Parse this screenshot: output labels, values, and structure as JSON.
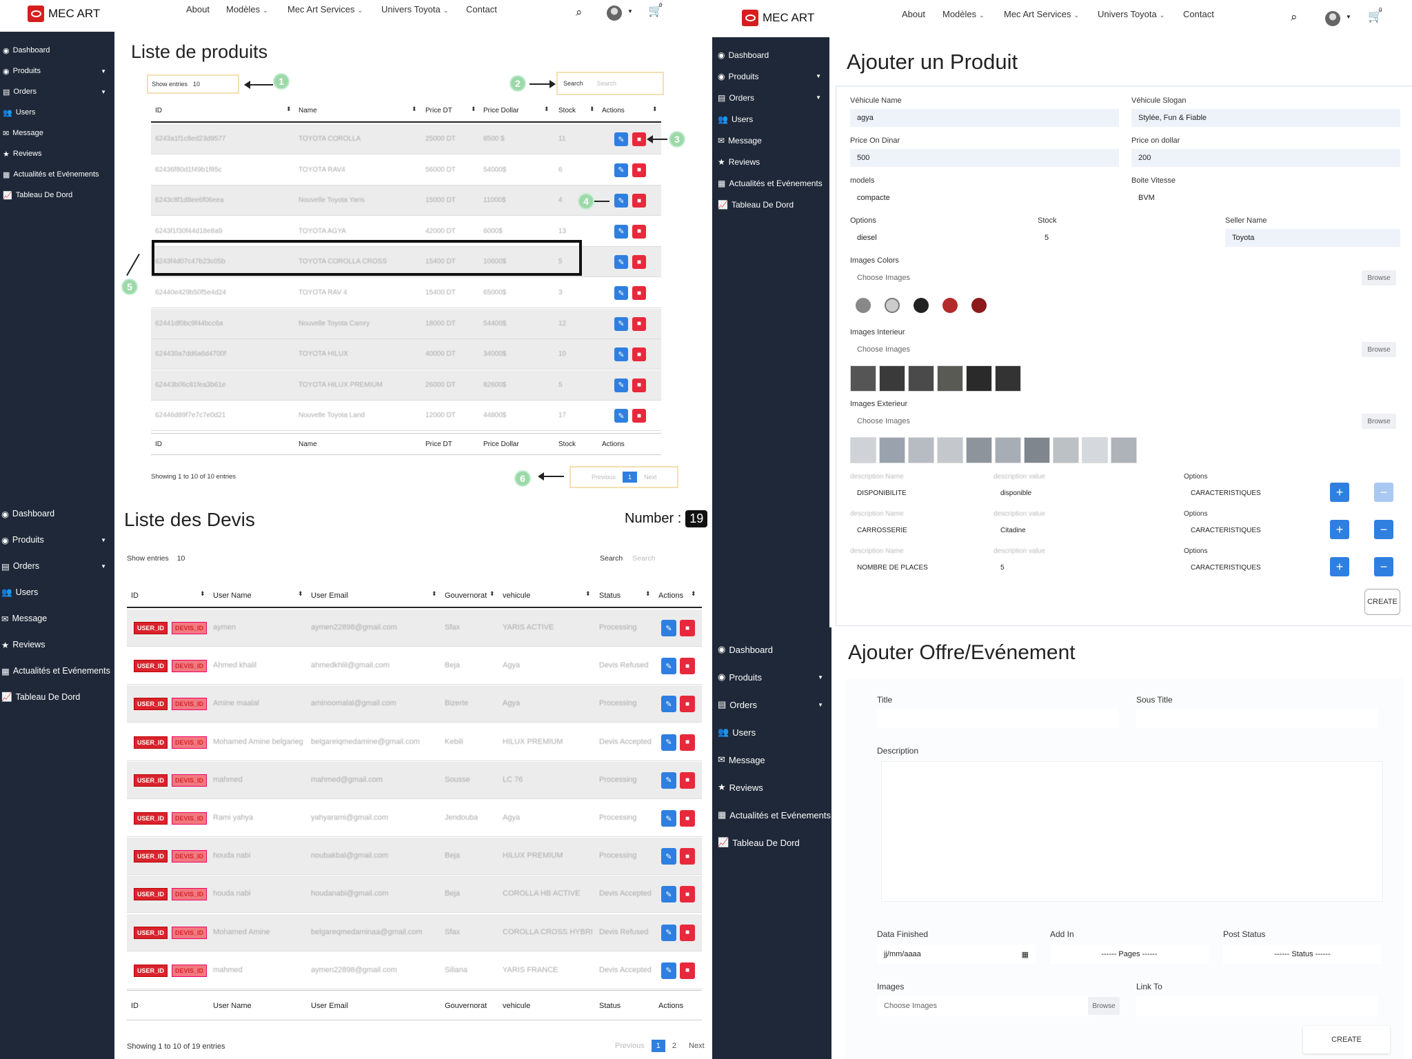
{
  "nav": {
    "brand": "MEC ART",
    "items": [
      "About",
      "Modèles",
      "Mec Art Services",
      "Univers Toyota",
      "Contact"
    ],
    "cart_count": "0"
  },
  "sidebar": [
    "Dashboard",
    "Produits",
    "Orders",
    "Users",
    "Message",
    "Reviews",
    "Actualités et Evénements",
    "Tableau De Dord"
  ],
  "products": {
    "title": "Liste de produits",
    "show_entries": "Show entries",
    "show_value": "10",
    "search_label": "Search",
    "search_placeholder": "Search",
    "columns": [
      "ID",
      "Name",
      "Price DT",
      "Price Dollar",
      "Stock",
      "Actions"
    ],
    "rows": [
      [
        "6243a1f1c8ed23d9577",
        "TOYOTA COROLLA",
        "25000 DT",
        "8500 $",
        "11"
      ],
      [
        "62436f80d1f49b1f85c",
        "TOYOTA RAV4 ",
        "56000 DT",
        "54000$",
        "6"
      ],
      [
        "6243c8f1d8ee6f06eea",
        "Nouvelle Toyota Yaris",
        "15000 DT",
        "11000$",
        "4"
      ],
      [
        "6243f1f30f44d18e8a9",
        "TOYOTA AGYA",
        "42000 DT",
        "6000$",
        "13"
      ],
      [
        "6243f4d07c47b23c05b",
        "TOYOTA COROLLA CROSS",
        "15400 DT",
        "10600$",
        "5"
      ],
      [
        "62440e429b50f5e4d24",
        "TOYOTA RAV 4",
        "15400 DT",
        "65000$",
        "3"
      ],
      [
        "62441df0bc9f44bcc6a",
        "Nouvelle Toyota Camry",
        "18000 DT",
        "54400$",
        "12"
      ],
      [
        "624430a7dd6a6d4700f",
        "TOYOTA HILUX",
        "40000 DT",
        "34000$",
        "10"
      ],
      [
        "62443b06c81fea3b61e",
        "TOYOTA HILUX PREMIUM",
        "26000 DT",
        "82600$",
        "5"
      ],
      [
        "62446d89f7e7c7e0d21",
        "Nouvelle Toyota Land",
        "12000 DT",
        "44800$",
        "17"
      ]
    ],
    "showing": "Showing 1 to 10 of 10 entries",
    "prev": "Previous",
    "page": "1",
    "next": "Next",
    "markers": [
      "1",
      "2",
      "3",
      "4",
      "5",
      "6"
    ]
  },
  "devis": {
    "title": "Liste des Devis",
    "number_label": "Number :",
    "number": "19",
    "show_entries": "Show entries",
    "show_value": "10",
    "search_label": "Search",
    "search_placeholder": "Search",
    "columns": [
      "ID",
      "User Name",
      "User Email",
      "Gouvernorat",
      "vehicule",
      "Status",
      "Actions"
    ],
    "badge_user": "USER_ID",
    "badge_devis": "DEVIS_ID",
    "rows": [
      [
        "aymen",
        "aymen22898@gmail.com",
        "Sfax",
        "YARIS ACTIVE",
        "Processing"
      ],
      [
        "Ahmed khalil",
        "ahmedkhlil@gmail.com",
        "Beja",
        "Agya",
        "Devis Refused"
      ],
      [
        "Amine maalal",
        "aminoomalal@gmail.com",
        "Bizerte",
        "Agya",
        "Processing"
      ],
      [
        "Mohamed Amine belgarieg",
        "belgareiqmedamine@gmail.com",
        "Kebili",
        "HILUX PREMIUM",
        "Devis Accepted"
      ],
      [
        "mahmed",
        "mahmed@gmail.com",
        "Sousse",
        "LC 76",
        "Processing"
      ],
      [
        "Rami yahya",
        "yahyarami@gmail.com",
        "Jendouba",
        "Agya",
        "Processing"
      ],
      [
        "houda nabi",
        "noubakbal@gmail.com",
        "Beja",
        "HILUX PREMIUM",
        "Processing"
      ],
      [
        "houda nabi",
        "houdanabi@gmail.com",
        "Beja",
        "COROLLA HB ACTIVE",
        "Devis Accepted"
      ],
      [
        "Mohamed Amine",
        "belgareqmedaminaa@gmail.com",
        "Sfax",
        "COROLLA CROSS HYBRID",
        "Devis Refused"
      ],
      [
        "mahmed",
        "aymen22898@gmail.com",
        "Siliana",
        "YARIS FRANCE",
        "Devis Accepted"
      ]
    ],
    "showing": "Showing 1 to 10 of 19 entries",
    "prev": "Previous",
    "pages": [
      "1",
      "2"
    ],
    "next": "Next"
  },
  "add_product": {
    "title": "Ajouter un Produit",
    "vehicule_name_label": "Véhicule Name",
    "vehicule_name": "agya",
    "slogan_label": "Véhicule Slogan",
    "slogan": "Stylée, Fun & Fiable",
    "price_dinar_label": "Price On Dinar",
    "price_dinar": "500",
    "price_dollar_label": "Price on dollar",
    "price_dollar": "200",
    "models_label": "models",
    "models": "compacte",
    "boite_label": "Boite Vitesse",
    "boite": "BVM",
    "options_label": "Options",
    "options": "diesel",
    "stock_label": "Stock",
    "stock": "5",
    "seller_label": "Seller Name",
    "seller": "Toyota",
    "images_colors_label": "Images Colors",
    "images_interieur_label": "Images Interieur",
    "images_exterieur_label": "Images Exterieur",
    "choose_images": "Choose Images",
    "browse": "Browse",
    "desc_name_label": "description Name",
    "desc_value_label": "description value",
    "options_col_label": "Options",
    "desc_rows": [
      {
        "name": "DISPONIBILITE",
        "value": "disponible",
        "option": "CARACTERISTIQUES"
      },
      {
        "name": "CARROSSERIE",
        "value": "Citadine",
        "option": "CARACTERISTIQUES"
      },
      {
        "name": "NOMBRE DE PLACES",
        "value": "5",
        "option": "CARACTERISTIQUES"
      }
    ],
    "create": "CREATE"
  },
  "add_offer": {
    "title": "Ajouter Offre/Evénement",
    "title_label": "Title",
    "sous_title_label": "Sous Title",
    "description_label": "Description",
    "date_label": "Data Finished",
    "date_placeholder": "jj/mm/aaaa",
    "add_in_label": "Add In",
    "add_in_value": "------ Pages ------",
    "post_status_label": "Post Status",
    "post_status_value": "------ Status ------",
    "images_label": "Images",
    "choose_images": "Choose Images",
    "browse": "Browse",
    "link_label": "Link To",
    "create": "CREATE"
  },
  "colors": {
    "sidebar": "#1f2838",
    "accent": "#2f7fe0",
    "danger": "#e8283c",
    "brand": "#d61e1e"
  }
}
